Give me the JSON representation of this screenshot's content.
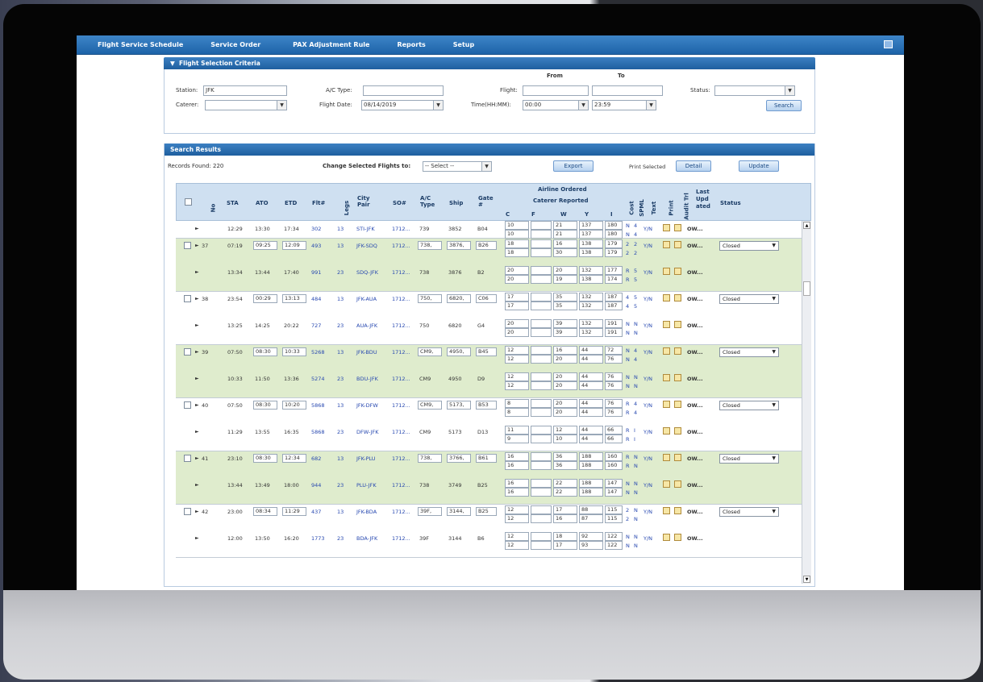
{
  "menu": {
    "items": [
      "Flight Service Schedule",
      "Service Order",
      "PAX Adjustment Rule",
      "Reports",
      "Setup"
    ]
  },
  "criteria": {
    "title": "Flight Selection Criteria",
    "from_label": "From",
    "to_label": "To",
    "station_label": "Station:",
    "station_value": "JFK",
    "caterer_label": "Caterer:",
    "caterer_value": "",
    "ac_type_label": "A/C Type:",
    "ac_type_value": "",
    "flight_date_label": "Flight Date:",
    "flight_date_value": "08/14/2019",
    "flight_label": "Flight:",
    "flight_from": "",
    "flight_to": "",
    "time_label": "Time(HH:MM):",
    "time_from": "00:00",
    "time_to": "23:59",
    "status_label": "Status:",
    "status_value": "",
    "search_button": "Search"
  },
  "results": {
    "title": "Search Results",
    "records_found": "Records Found: 220",
    "change_label": "Change Selected Flights to:",
    "change_value": "-- Select --",
    "export_button": "Export",
    "print_selected": "Print Selected",
    "detail_button": "Detail",
    "update_button": "Update",
    "headers": {
      "no": "No",
      "sta_col": "STA",
      "ato": "ATO",
      "etd": "ETD",
      "flt": "Flt#",
      "legs": "Legs",
      "city_pair": "City Pair",
      "so": "SO#",
      "ac_type": "A/C Type",
      "ship": "Ship",
      "gate": "Gate #",
      "airline_ordered": "Airline Ordered",
      "caterer_reported": "Caterer Reported",
      "c": "C",
      "f": "F",
      "w": "W",
      "y": "Y",
      "i": "I",
      "cost": "Cost",
      "spml": "SPML",
      "text": "Text",
      "print": "Print",
      "audit": "Audit Trl",
      "last_updated": "Last Upd ated",
      "status": "Status"
    },
    "groups": [
      {
        "no": "",
        "color": "white",
        "rows": [
          {
            "sta": "12:29",
            "ato": "13:30",
            "etd": "17:34",
            "flt": "302",
            "legs": "13",
            "city": "STI-JFK",
            "so": "1712...",
            "ac": "739",
            "ship": "3852",
            "gate": "B04",
            "q": [
              [
                "10",
                "",
                "21",
                "137",
                "180"
              ],
              [
                "10",
                "",
                "21",
                "137",
                "180"
              ]
            ],
            "flags": [
              "N",
              "4"
            ],
            "status": ""
          }
        ]
      },
      {
        "no": "37",
        "color": "green",
        "rows": [
          {
            "sta": "07:19",
            "ato": "09:25",
            "etd": "12:09",
            "flt": "493",
            "legs": "13",
            "city": "JFK-SDQ",
            "so": "1712...",
            "ac": "738,",
            "ship": "3876,",
            "gate": "B26",
            "q": [
              [
                "18",
                "",
                "16",
                "138",
                "179"
              ],
              [
                "18",
                "",
                "30",
                "138",
                "179"
              ]
            ],
            "flags": [
              "2",
              "2"
            ],
            "status": "Closed"
          },
          {
            "sta": "13:34",
            "ato": "13:44",
            "etd": "17:40",
            "flt": "991",
            "legs": "23",
            "city": "SDQ-JFK",
            "so": "1712...",
            "ac": "738",
            "ship": "3876",
            "gate": "B2",
            "q": [
              [
                "20",
                "",
                "20",
                "132",
                "177"
              ],
              [
                "20",
                "",
                "19",
                "138",
                "174"
              ]
            ],
            "flags": [
              "R",
              "5"
            ],
            "status": ""
          }
        ]
      },
      {
        "no": "38",
        "color": "white",
        "rows": [
          {
            "sta": "23:54",
            "ato": "00:29",
            "etd": "13:13",
            "flt": "484",
            "legs": "13",
            "city": "JFK-AUA",
            "so": "1712...",
            "ac": "750,",
            "ship": "6820,",
            "gate": "C06",
            "q": [
              [
                "17",
                "",
                "35",
                "132",
                "187"
              ],
              [
                "17",
                "",
                "35",
                "132",
                "187"
              ]
            ],
            "flags": [
              "4",
              "5"
            ],
            "status": "Closed"
          },
          {
            "sta": "13:25",
            "ato": "14:25",
            "etd": "20:22",
            "flt": "727",
            "legs": "23",
            "city": "AUA-JFK",
            "so": "1712...",
            "ac": "750",
            "ship": "6820",
            "gate": "G4",
            "q": [
              [
                "20",
                "",
                "39",
                "132",
                "191"
              ],
              [
                "20",
                "",
                "39",
                "132",
                "191"
              ]
            ],
            "flags": [
              "N",
              "N"
            ],
            "status": ""
          }
        ]
      },
      {
        "no": "39",
        "color": "green",
        "rows": [
          {
            "sta": "07:50",
            "ato": "08:30",
            "etd": "10:33",
            "flt": "5268",
            "legs": "13",
            "city": "JFK-BDU",
            "so": "1712...",
            "ac": "CM9,",
            "ship": "4950,",
            "gate": "B45",
            "q": [
              [
                "12",
                "",
                "16",
                "44",
                "72"
              ],
              [
                "12",
                "",
                "20",
                "44",
                "76"
              ]
            ],
            "flags": [
              "N",
              "4"
            ],
            "status": "Closed"
          },
          {
            "sta": "10:33",
            "ato": "11:50",
            "etd": "13:36",
            "flt": "5274",
            "legs": "23",
            "city": "BDU-JFK",
            "so": "1712...",
            "ac": "CM9",
            "ship": "4950",
            "gate": "D9",
            "q": [
              [
                "12",
                "",
                "20",
                "44",
                "76"
              ],
              [
                "12",
                "",
                "20",
                "44",
                "76"
              ]
            ],
            "flags": [
              "N",
              "N"
            ],
            "status": ""
          }
        ]
      },
      {
        "no": "40",
        "color": "white",
        "rows": [
          {
            "sta": "07:50",
            "ato": "08:30",
            "etd": "10:20",
            "flt": "5868",
            "legs": "13",
            "city": "JFK-DFW",
            "so": "1712...",
            "ac": "CM9,",
            "ship": "5173,",
            "gate": "B53",
            "q": [
              [
                "8",
                "",
                "20",
                "44",
                "76"
              ],
              [
                "8",
                "",
                "20",
                "44",
                "76"
              ]
            ],
            "flags": [
              "R",
              "4"
            ],
            "status": "Closed"
          },
          {
            "sta": "11:29",
            "ato": "13:55",
            "etd": "16:35",
            "flt": "5868",
            "legs": "23",
            "city": "DFW-JFK",
            "so": "1712...",
            "ac": "CM9",
            "ship": "5173",
            "gate": "D13",
            "q": [
              [
                "11",
                "",
                "12",
                "44",
                "66"
              ],
              [
                "9",
                "",
                "10",
                "44",
                "66"
              ]
            ],
            "flags": [
              "R",
              "I"
            ],
            "status": ""
          }
        ]
      },
      {
        "no": "41",
        "color": "green",
        "rows": [
          {
            "sta": "23:10",
            "ato": "08:30",
            "etd": "12:34",
            "flt": "682",
            "legs": "13",
            "city": "JFK-PLU",
            "so": "1712...",
            "ac": "738,",
            "ship": "3766,",
            "gate": "B61",
            "q": [
              [
                "16",
                "",
                "36",
                "188",
                "160"
              ],
              [
                "16",
                "",
                "36",
                "188",
                "160"
              ]
            ],
            "flags": [
              "R",
              "N"
            ],
            "status": "Closed"
          },
          {
            "sta": "13:44",
            "ato": "13:49",
            "etd": "18:00",
            "flt": "944",
            "legs": "23",
            "city": "PLU-JFK",
            "so": "1712...",
            "ac": "738",
            "ship": "3749",
            "gate": "B25",
            "q": [
              [
                "16",
                "",
                "22",
                "188",
                "147"
              ],
              [
                "16",
                "",
                "22",
                "188",
                "147"
              ]
            ],
            "flags": [
              "N",
              "N"
            ],
            "status": ""
          }
        ]
      },
      {
        "no": "42",
        "color": "white",
        "rows": [
          {
            "sta": "23:00",
            "ato": "08:34",
            "etd": "11:29",
            "flt": "437",
            "legs": "13",
            "city": "JFK-BDA",
            "so": "1712...",
            "ac": "39F,",
            "ship": "3144,",
            "gate": "B25",
            "q": [
              [
                "12",
                "",
                "17",
                "88",
                "115"
              ],
              [
                "12",
                "",
                "16",
                "87",
                "115"
              ]
            ],
            "flags": [
              "2",
              "N"
            ],
            "status": "Closed"
          },
          {
            "sta": "12:00",
            "ato": "13:50",
            "etd": "16:20",
            "flt": "1773",
            "legs": "23",
            "city": "BDA-JFK",
            "so": "1712...",
            "ac": "39F",
            "ship": "3144",
            "gate": "B6",
            "q": [
              [
                "12",
                "",
                "18",
                "92",
                "122"
              ],
              [
                "12",
                "",
                "17",
                "93",
                "122"
              ]
            ],
            "flags": [
              "N",
              "N"
            ],
            "status": ""
          }
        ]
      }
    ],
    "yn": "Y/N",
    "ow": "OW..."
  }
}
